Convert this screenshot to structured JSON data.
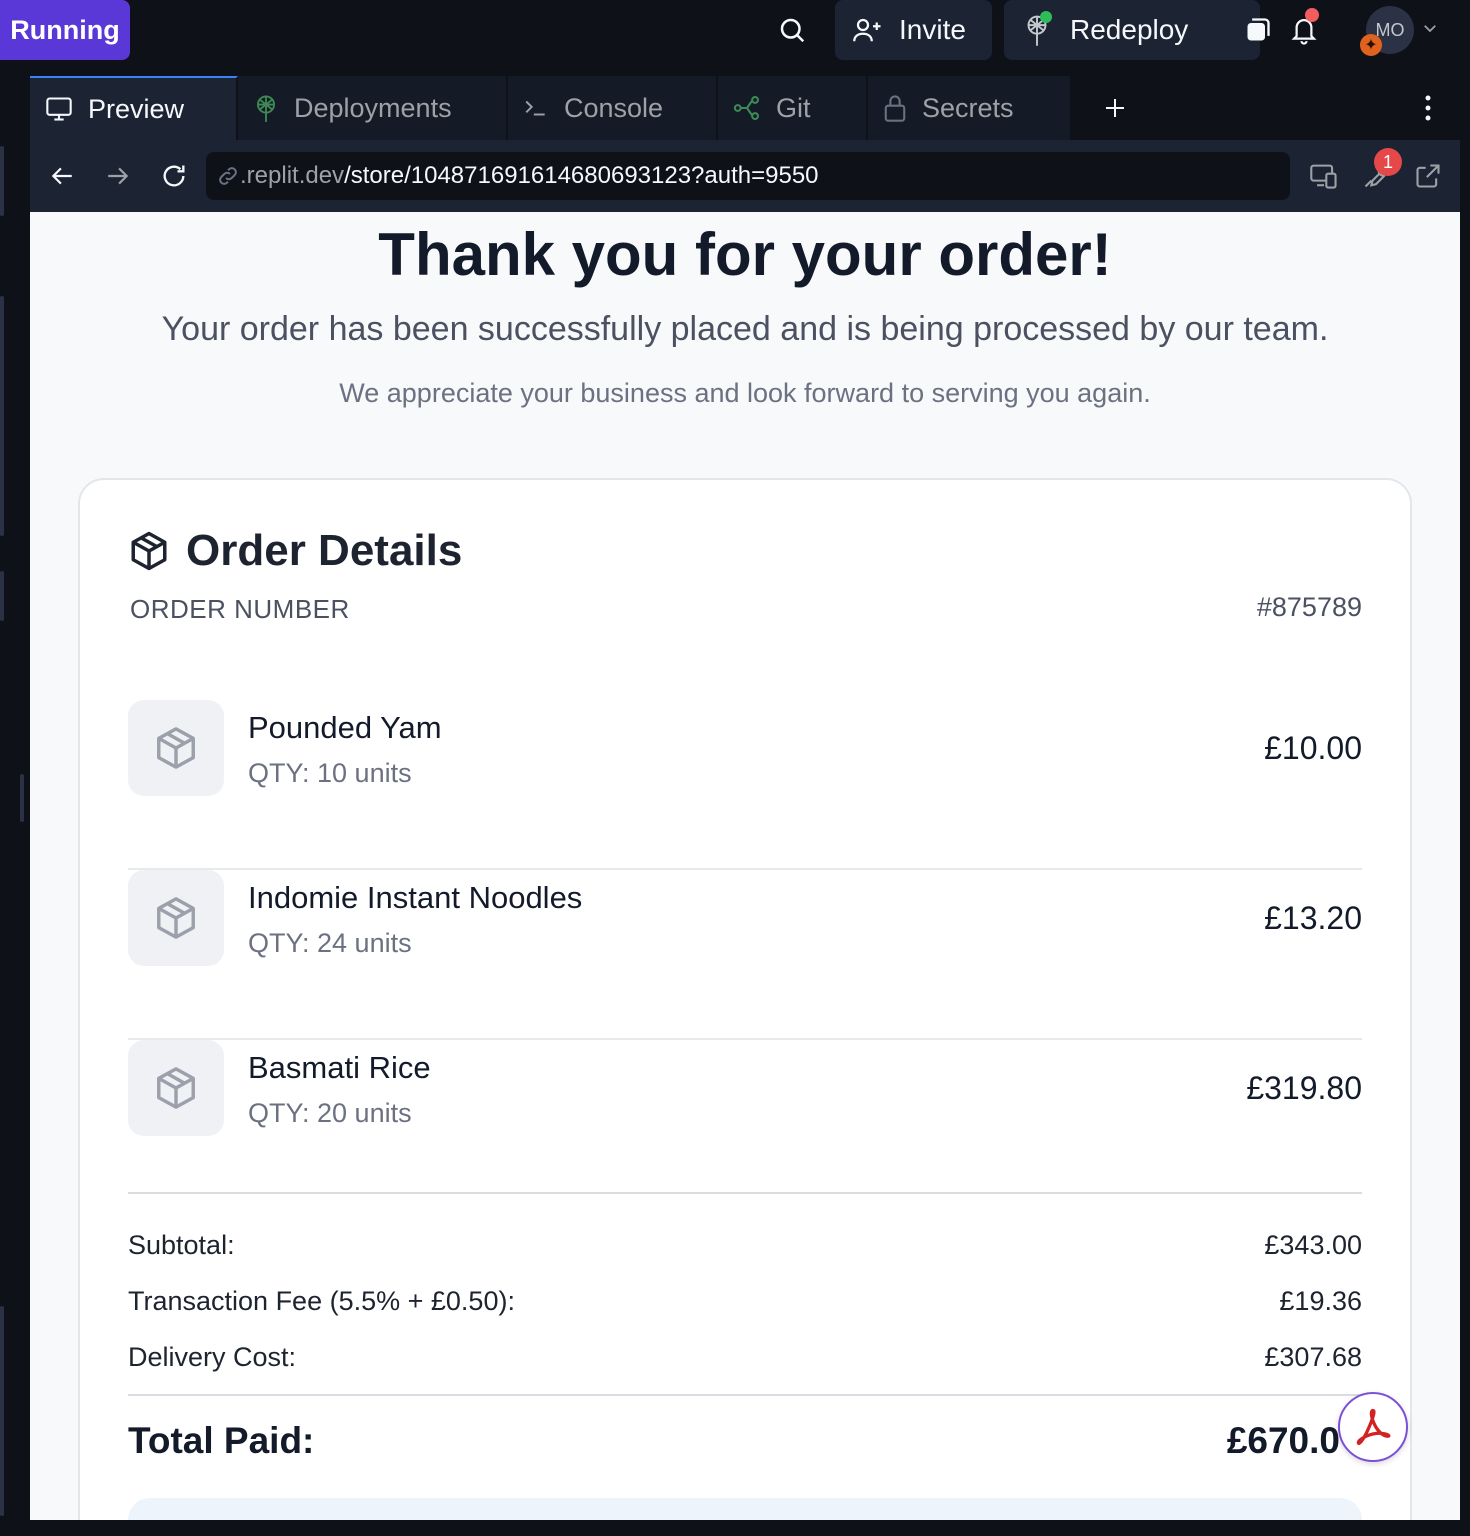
{
  "topbar": {
    "run_label": "Running",
    "invite_label": "Invite",
    "redeploy_label": "Redeploy",
    "avatar_initials": "MO"
  },
  "tabs": [
    {
      "label": "Preview",
      "icon": "monitor-icon",
      "active": true
    },
    {
      "label": "Deployments",
      "icon": "deployments-icon",
      "active": false
    },
    {
      "label": "Console",
      "icon": "terminal-icon",
      "active": false
    },
    {
      "label": "Git",
      "icon": "git-icon",
      "active": false
    },
    {
      "label": "Secrets",
      "icon": "lock-icon",
      "active": false
    }
  ],
  "address": {
    "domain": ".replit.dev",
    "path": "/store/1048716916146806931​23?auth=9550",
    "devtools_badge": "1"
  },
  "page": {
    "title": "Thank you for your order!",
    "subtitle": "Your order has been successfully placed and is being processed by our team.",
    "note": "We appreciate your business and look forward to serving you again.",
    "card_title": "Order Details",
    "order_number_label": "ORDER NUMBER",
    "order_number": "#875789",
    "items": [
      {
        "name": "Pounded Yam",
        "qty": "QTY: 10 units",
        "price": "£10.00"
      },
      {
        "name": "Indomie Instant Noodles",
        "qty": "QTY: 24 units",
        "price": "£13.20"
      },
      {
        "name": "Basmati Rice",
        "qty": "QTY: 20 units",
        "price": "£319.80"
      }
    ],
    "summary": {
      "subtotal_label": "Subtotal:",
      "subtotal": "£343.00",
      "fee_label": "Transaction Fee (5.5% + £0.50):",
      "fee": "£19.36",
      "delivery_label": "Delivery Cost:",
      "delivery": "£307.68",
      "total_label": "Total Paid:",
      "total": "£670.0"
    }
  },
  "colors": {
    "accent": "#5a38d8",
    "tab_indicator": "#3b82f6",
    "notification": "#f45d5d"
  }
}
